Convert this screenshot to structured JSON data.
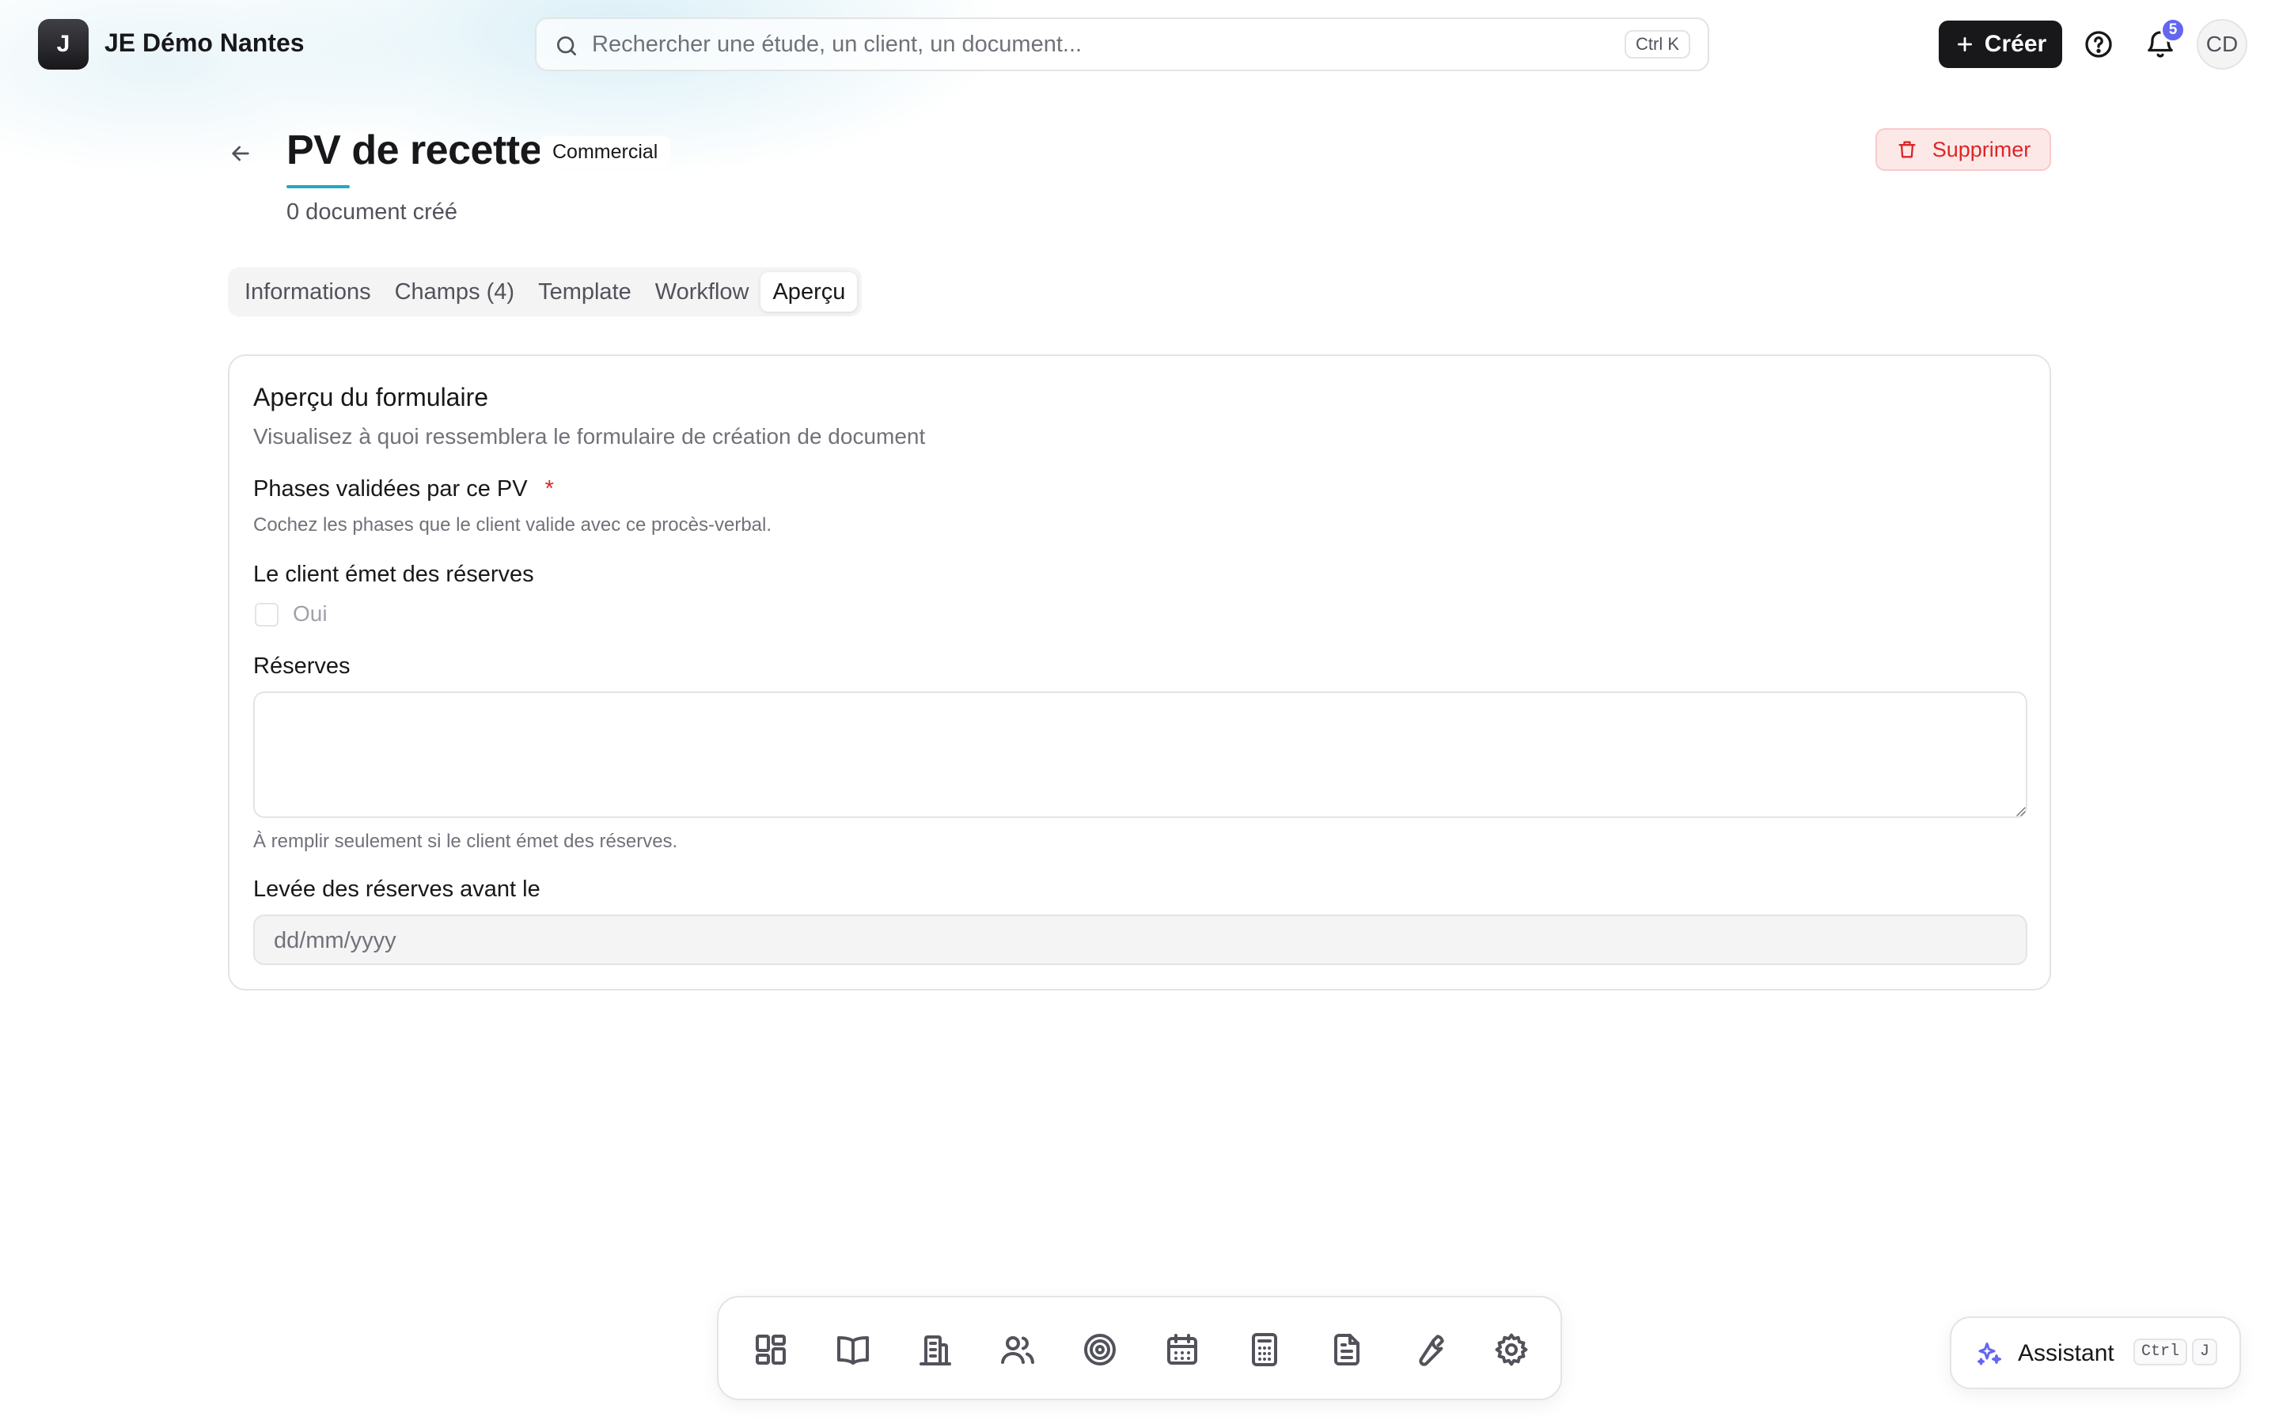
{
  "header": {
    "logo_letter": "J",
    "org_name": "JE Démo Nantes",
    "search_placeholder": "Rechercher une étude, un client, un document...",
    "search_shortcut": "Ctrl K",
    "create_label": "Créer",
    "notification_count": "5",
    "avatar_initials": "CD"
  },
  "page": {
    "title": "PV de recette",
    "category": "Commercial",
    "document_count": "0 document créé",
    "delete_label": "Supprimer"
  },
  "tabs": [
    {
      "label": "Informations",
      "active": false
    },
    {
      "label": "Champs (4)",
      "active": false
    },
    {
      "label": "Template",
      "active": false
    },
    {
      "label": "Workflow",
      "active": false
    },
    {
      "label": "Aperçu",
      "active": true
    }
  ],
  "preview": {
    "title": "Aperçu du formulaire",
    "description": "Visualisez à quoi ressemblera le formulaire de création de document",
    "fields": {
      "phases": {
        "label": "Phases validées par ce PV",
        "required_mark": "*",
        "help": "Cochez les phases que le client valide avec ce procès-verbal."
      },
      "client_reserves": {
        "label": "Le client émet des réserves",
        "checkbox_label": "Oui"
      },
      "reserves": {
        "label": "Réserves",
        "help": "À remplir seulement si le client émet des réserves."
      },
      "deadline": {
        "label": "Levée des réserves avant le",
        "placeholder": "dd/mm/yyyy"
      }
    }
  },
  "dock": {
    "items": [
      "dashboard-icon",
      "book-icon",
      "building-icon",
      "users-icon",
      "target-icon",
      "calendar-icon",
      "calculator-icon",
      "document-icon",
      "wrench-icon",
      "settings-icon"
    ]
  },
  "assistant": {
    "label": "Assistant",
    "shortcut_key1": "Ctrl",
    "shortcut_key2": "J"
  },
  "colors": {
    "accent": "#22a8c4",
    "danger": "#dc2626",
    "badge": "#6366f1",
    "primary_button": "#18181b"
  }
}
